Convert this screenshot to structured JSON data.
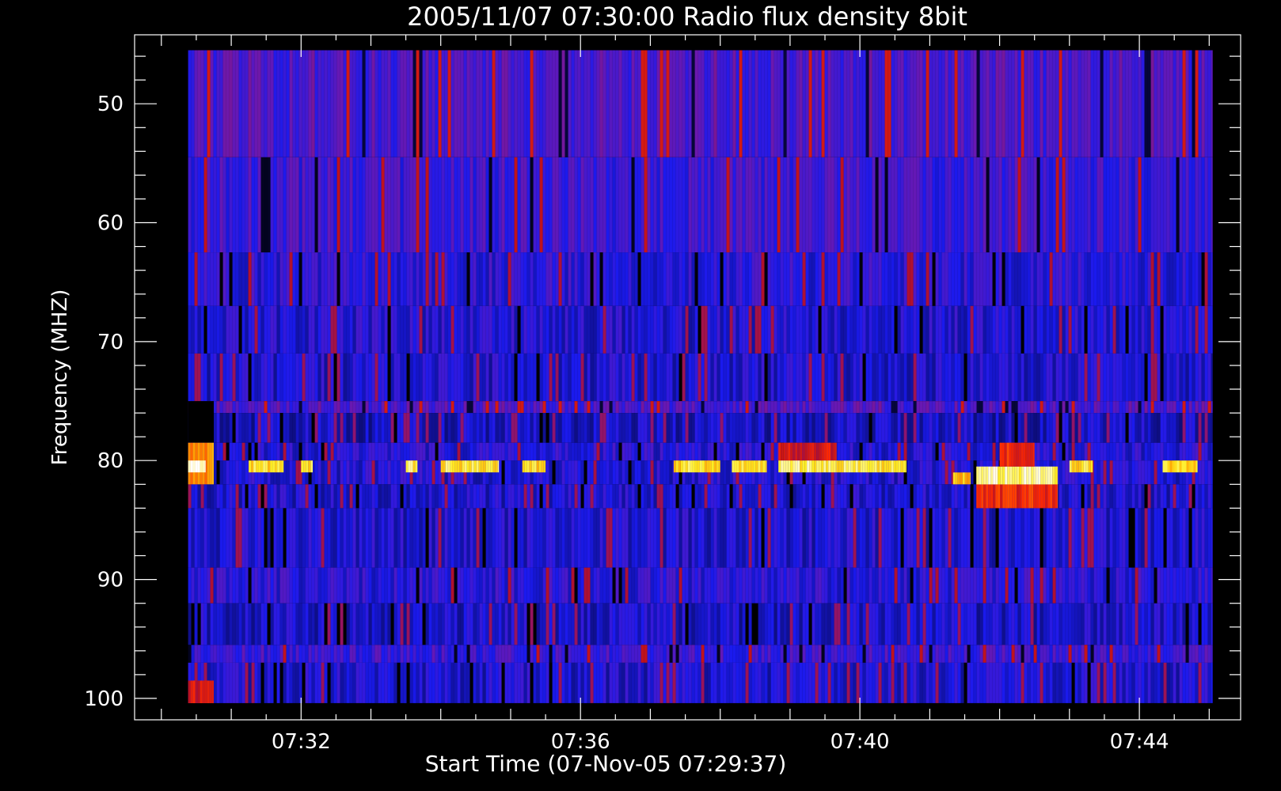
{
  "chart_data": {
    "type": "heatmap",
    "title": "2005/11/07 07:30:00 Radio flux density 8bit",
    "xlabel": "Start Time (07-Nov-05 07:29:37)",
    "ylabel": "Frequency (MHZ)",
    "x_range": [
      "07:29:37",
      "07:45:27"
    ],
    "data_x_range": [
      "07:30:23",
      "07:45:03"
    ],
    "y_range": [
      44.2,
      101.8
    ],
    "data_y_range": [
      45.5,
      100.4
    ],
    "x_ticks": [
      "07:32",
      "07:36",
      "07:40",
      "07:44"
    ],
    "y_ticks": [
      50,
      60,
      70,
      80,
      90,
      100
    ],
    "y_reversed": true,
    "colormap": [
      "#000000",
      "#0a0a60",
      "#1a1aee",
      "#6a18b0",
      "#b81020",
      "#ff2a00",
      "#ff9a00",
      "#ffee22",
      "#ffffff"
    ],
    "frequency_bands": [
      {
        "freq": [
          45.5,
          54.5
        ],
        "level": 0.33
      },
      {
        "freq": [
          54.5,
          62.5
        ],
        "level": 0.3
      },
      {
        "freq": [
          62.5,
          67
        ],
        "level": 0.27
      },
      {
        "freq": [
          67,
          71
        ],
        "level": 0.25
      },
      {
        "freq": [
          71,
          75
        ],
        "level": 0.24
      },
      {
        "freq": [
          75,
          76
        ],
        "level": 0.33
      },
      {
        "freq": [
          76,
          78.5
        ],
        "level": 0.22
      },
      {
        "freq": [
          78.5,
          80
        ],
        "level": 0.26
      },
      {
        "freq": [
          80,
          82
        ],
        "level": 0.25
      },
      {
        "freq": [
          82,
          84
        ],
        "level": 0.24
      },
      {
        "freq": [
          84,
          89
        ],
        "level": 0.24
      },
      {
        "freq": [
          89,
          92
        ],
        "level": 0.27
      },
      {
        "freq": [
          92,
          95.5
        ],
        "level": 0.23
      },
      {
        "freq": [
          95.5,
          97
        ],
        "level": 0.3
      },
      {
        "freq": [
          97,
          100.4
        ],
        "level": 0.24
      }
    ],
    "missing_data": {
      "time": [
        "07:30:23",
        "07:30:45"
      ],
      "freq": [
        75,
        78.5
      ]
    },
    "bursts": [
      {
        "time": [
          "07:30:23",
          "07:30:45"
        ],
        "freq": [
          78.5,
          82
        ],
        "level": 0.72
      },
      {
        "time": [
          "07:30:23",
          "07:30:38"
        ],
        "freq": [
          80,
          81
        ],
        "level": 1.0
      },
      {
        "time": [
          "07:30:23",
          "07:30:45"
        ],
        "freq": [
          98.5,
          100.4
        ],
        "level": 0.55
      },
      {
        "time": [
          "07:31:15",
          "07:31:45"
        ],
        "freq": [
          80,
          81
        ],
        "level": 0.85
      },
      {
        "time": [
          "07:32:00",
          "07:32:10"
        ],
        "freq": [
          80,
          81
        ],
        "level": 0.85
      },
      {
        "time": [
          "07:33:30",
          "07:33:40"
        ],
        "freq": [
          80,
          81
        ],
        "level": 0.88
      },
      {
        "time": [
          "07:34:00",
          "07:34:50"
        ],
        "freq": [
          80,
          81
        ],
        "level": 0.87
      },
      {
        "time": [
          "07:35:10",
          "07:35:30"
        ],
        "freq": [
          80,
          81
        ],
        "level": 0.84
      },
      {
        "time": [
          "07:37:20",
          "07:38:00"
        ],
        "freq": [
          80,
          81
        ],
        "level": 0.86
      },
      {
        "time": [
          "07:38:10",
          "07:38:40"
        ],
        "freq": [
          80,
          81
        ],
        "level": 0.84
      },
      {
        "time": [
          "07:38:50",
          "07:39:40"
        ],
        "freq": [
          78.5,
          80
        ],
        "level": 0.55
      },
      {
        "time": [
          "07:38:50",
          "07:39:40"
        ],
        "freq": [
          80,
          81
        ],
        "level": 0.9
      },
      {
        "time": [
          "07:39:40",
          "07:40:40"
        ],
        "freq": [
          80,
          81
        ],
        "level": 0.88
      },
      {
        "time": [
          "07:41:20",
          "07:41:35"
        ],
        "freq": [
          81,
          82
        ],
        "level": 0.8
      },
      {
        "time": [
          "07:41:40",
          "07:42:50"
        ],
        "freq": [
          82,
          84
        ],
        "level": 0.6
      },
      {
        "time": [
          "07:41:40",
          "07:42:50"
        ],
        "freq": [
          80.5,
          82
        ],
        "level": 0.92
      },
      {
        "time": [
          "07:42:00",
          "07:42:30"
        ],
        "freq": [
          78.5,
          80.5
        ],
        "level": 0.6
      },
      {
        "time": [
          "07:43:00",
          "07:43:20"
        ],
        "freq": [
          80,
          81
        ],
        "level": 0.85
      },
      {
        "time": [
          "07:44:20",
          "07:44:50"
        ],
        "freq": [
          80,
          81
        ],
        "level": 0.84
      }
    ]
  }
}
